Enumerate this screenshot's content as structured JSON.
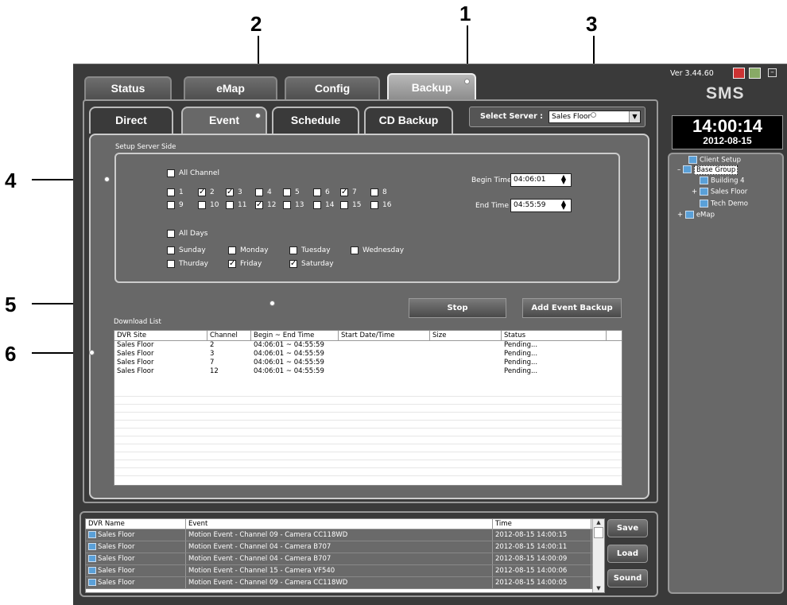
{
  "callouts": [
    "1",
    "2",
    "3",
    "4",
    "5",
    "6"
  ],
  "version": "Ver 3.44.60",
  "logo": "SMS",
  "clock": {
    "time": "14:00:14",
    "date": "2012-08-15"
  },
  "main_tabs": [
    "Status",
    "eMap",
    "Config",
    "Backup"
  ],
  "sub_tabs": [
    "Direct",
    "Event",
    "Schedule",
    "CD Backup"
  ],
  "server": {
    "label": "Select Server :",
    "value": "Sales Floor"
  },
  "setup": {
    "section_label": "Setup Server Side",
    "all_channel": "All Channel",
    "all_days": "All Days",
    "begin_label": "Begin Time",
    "begin_value": "04:06:01",
    "end_label": "End Time",
    "end_value": "04:55:59"
  },
  "channels": [
    {
      "n": "1",
      "c": false
    },
    {
      "n": "2",
      "c": true
    },
    {
      "n": "3",
      "c": true
    },
    {
      "n": "4",
      "c": false
    },
    {
      "n": "5",
      "c": false
    },
    {
      "n": "6",
      "c": false
    },
    {
      "n": "7",
      "c": true
    },
    {
      "n": "8",
      "c": false
    },
    {
      "n": "9",
      "c": false
    },
    {
      "n": "10",
      "c": false
    },
    {
      "n": "11",
      "c": false
    },
    {
      "n": "12",
      "c": true
    },
    {
      "n": "13",
      "c": false
    },
    {
      "n": "14",
      "c": false
    },
    {
      "n": "15",
      "c": false
    },
    {
      "n": "16",
      "c": false
    }
  ],
  "days": [
    {
      "n": "Sunday",
      "c": false
    },
    {
      "n": "Monday",
      "c": false
    },
    {
      "n": "Tuesday",
      "c": false
    },
    {
      "n": "Wednesday",
      "c": false
    },
    {
      "n": "Thurday",
      "c": false
    },
    {
      "n": "Friday",
      "c": true
    },
    {
      "n": "Saturday",
      "c": true
    }
  ],
  "buttons": {
    "stop": "Stop",
    "add": "Add Event Backup",
    "save": "Save",
    "load": "Load",
    "sound": "Sound"
  },
  "download": {
    "label": "Download List",
    "columns": [
      "DVR Site",
      "Channel",
      "Begin ~ End Time",
      "Start Date/Time",
      "Size",
      "Status"
    ],
    "rows": [
      [
        "Sales Floor",
        "2",
        "04:06:01 ~ 04:55:59",
        "",
        "",
        "Pending..."
      ],
      [
        "Sales Floor",
        "3",
        "04:06:01 ~ 04:55:59",
        "",
        "",
        "Pending..."
      ],
      [
        "Sales Floor",
        "7",
        "04:06:01 ~ 04:55:59",
        "",
        "",
        "Pending..."
      ],
      [
        "Sales Floor",
        "12",
        "04:06:01 ~ 04:55:59",
        "",
        "",
        "Pending..."
      ]
    ]
  },
  "events": {
    "columns": [
      "DVR Name",
      "Event",
      "Time"
    ],
    "rows": [
      [
        "Sales Floor",
        "Motion Event  -  Channel 09  -  Camera CC118WD",
        "2012-08-15 14:00:15"
      ],
      [
        "Sales Floor",
        "Motion Event  -  Channel 04  -  Camera B707",
        "2012-08-15 14:00:11"
      ],
      [
        "Sales Floor",
        "Motion Event  -  Channel 04  -  Camera B707",
        "2012-08-15 14:00:09"
      ],
      [
        "Sales Floor",
        "Motion Event  -  Channel 15  -  Camera VF540",
        "2012-08-15 14:00:06"
      ],
      [
        "Sales Floor",
        "Motion Event  -  Channel 09  -  Camera CC118WD",
        "2012-08-15 14:00:05"
      ]
    ]
  },
  "tree": [
    "Client Setup",
    "Base Group",
    "Building 4",
    "Sales Floor",
    "Tech Demo",
    "eMap"
  ]
}
